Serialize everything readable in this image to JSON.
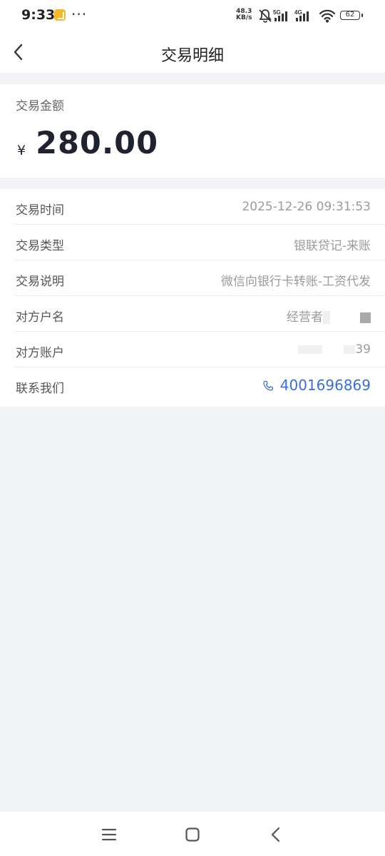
{
  "status_bar": {
    "time": "9:33",
    "dots": "···",
    "net_speed_value": "48.3",
    "net_speed_unit": "KB/s",
    "signal_5g": "5G",
    "signal_4g": "4G",
    "battery": "62"
  },
  "header": {
    "title": "交易明细",
    "back_icon": "chevron-left-icon"
  },
  "amount": {
    "label": "交易金额",
    "currency": "¥",
    "value": "280.00"
  },
  "details": {
    "time_label": "交易时间",
    "time_value": "2025-12-26 09:31:53",
    "type_label": "交易类型",
    "type_value": "银联贷记-来账",
    "desc_label": "交易说明",
    "desc_value": "微信向银行卡转账-工资代发",
    "name_label": "对方户名",
    "name_value": "经营者",
    "account_label": "对方账户",
    "account_value": "39",
    "contact_label": "联系我们",
    "contact_value": "4001696869"
  },
  "colors": {
    "accent": "#3a6fd8",
    "page_bg": "#f2f3f7",
    "amount_text": "#1f2230"
  },
  "bottom_nav": {
    "icons": [
      "menu-icon",
      "home-icon",
      "back-icon"
    ]
  }
}
